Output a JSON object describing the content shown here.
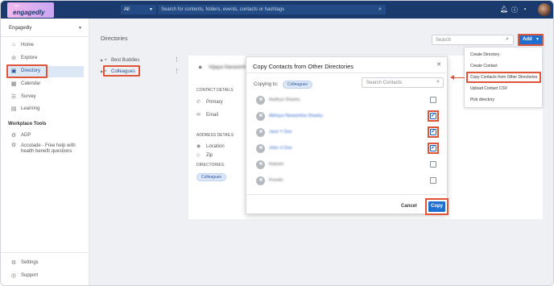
{
  "app": {
    "logo_text": "engagedly"
  },
  "topbar": {
    "scope_value": "All",
    "search_placeholder": "Search for contents, folders, events, contacts or hashtags",
    "icons": [
      "bell-icon",
      "help-icon",
      "chart-icon",
      "avatar"
    ]
  },
  "sidebar": {
    "workspace": "Engagedly",
    "items": [
      {
        "label": "Home",
        "icon": "home-icon"
      },
      {
        "label": "Explore",
        "icon": "compass-icon"
      },
      {
        "label": "Directory",
        "icon": "directory-icon",
        "active": true
      },
      {
        "label": "Calendar",
        "icon": "calendar-icon"
      },
      {
        "label": "Survey",
        "icon": "survey-icon"
      },
      {
        "label": "Learning",
        "icon": "learning-icon"
      }
    ],
    "tools_heading": "Workplace Tools",
    "tools": [
      {
        "label": "ADP",
        "icon": "gear-icon"
      },
      {
        "label": "Accolade - Free help with health benefit questions",
        "icon": "gear-icon"
      }
    ],
    "bottom": [
      {
        "label": "Settings",
        "icon": "gear-icon"
      },
      {
        "label": "Support",
        "icon": "support-icon"
      }
    ]
  },
  "main": {
    "title": "Directories",
    "search_placeholder": "Search",
    "add_label": "Add",
    "directories": [
      "Best Buddies",
      "Colleagues"
    ]
  },
  "detail": {
    "name": "Vijaya Narasimha",
    "contact_heading": "CONTACT DETAILS",
    "primary_label": "Primary",
    "email_label": "Email",
    "address_heading": "ADDRESS DETAILS",
    "location_label": "Location",
    "zip_label": "Zip",
    "directories_heading": "DIRECTORIES",
    "directory_tag": "Colleagues"
  },
  "dropdown": {
    "items": [
      "Create Directory",
      "Create Contact",
      "Copy Contacts from Other Directories",
      "Upload Contact CSV",
      "Pick directory"
    ],
    "highlighted_index": 2
  },
  "modal": {
    "title": "Copy Contacts from Other Directories",
    "copying_to_label": "Copying to:",
    "copying_to_value": "Colleagues",
    "search_placeholder": "Search Contacts",
    "contacts": [
      {
        "name": "Aadhya Shastry",
        "checked": false,
        "link": false
      },
      {
        "name": "Abhaya Narasimha Shastry",
        "checked": true,
        "link": true
      },
      {
        "name": "Jane Y Doe",
        "checked": true,
        "link": true
      },
      {
        "name": "John X Doe",
        "checked": true,
        "link": true
      },
      {
        "name": "Kalyani",
        "checked": false,
        "link": false
      },
      {
        "name": "Preethi",
        "checked": false,
        "link": false
      }
    ],
    "cancel_label": "Cancel",
    "copy_label": "Copy"
  },
  "colors": {
    "topbar": "#1a3a6e",
    "accent": "#1e6fcf",
    "highlight": "#e0553a"
  }
}
